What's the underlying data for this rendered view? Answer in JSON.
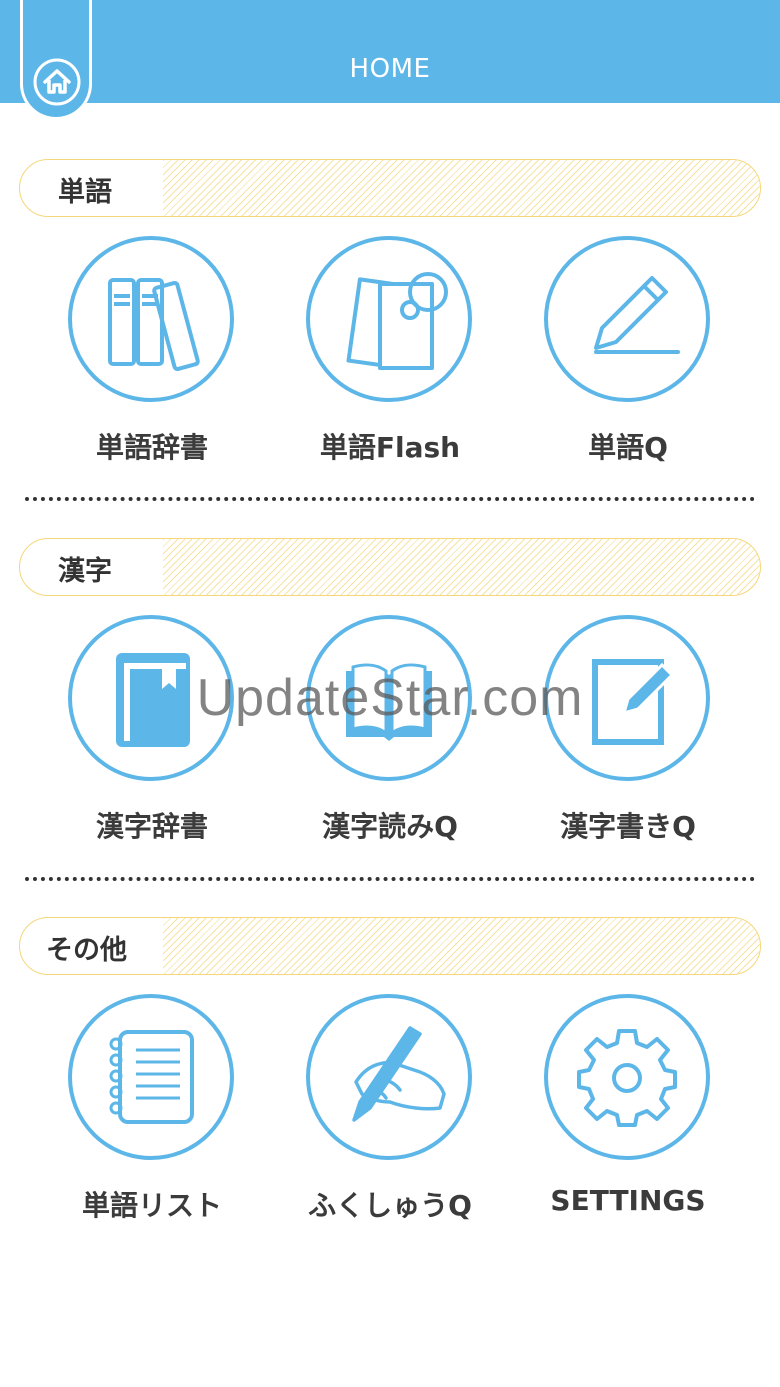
{
  "header": {
    "title": "HOME"
  },
  "sections": [
    {
      "title": "単語",
      "items": [
        {
          "label": "単語辞書",
          "icon": "books-icon"
        },
        {
          "label": "単語Flash",
          "icon": "flashcards-icon"
        },
        {
          "label": "単語Q",
          "icon": "pencil-icon"
        }
      ]
    },
    {
      "title": "漢字",
      "items": [
        {
          "label": "漢字辞書",
          "icon": "dictionary-book-icon"
        },
        {
          "label": "漢字読みQ",
          "icon": "open-book-icon"
        },
        {
          "label": "漢字書きQ",
          "icon": "note-pencil-icon"
        }
      ]
    },
    {
      "title": "その他",
      "items": [
        {
          "label": "単語リスト",
          "icon": "notebook-icon"
        },
        {
          "label": "ふくしゅうQ",
          "icon": "hand-writing-icon"
        },
        {
          "label": "SETTINGS",
          "icon": "gear-icon"
        }
      ]
    }
  ],
  "watermark": "UpdateStar.com",
  "colors": {
    "accent": "#5db6e8",
    "header_border": "#f4d77a",
    "text": "#3a3a3a"
  }
}
